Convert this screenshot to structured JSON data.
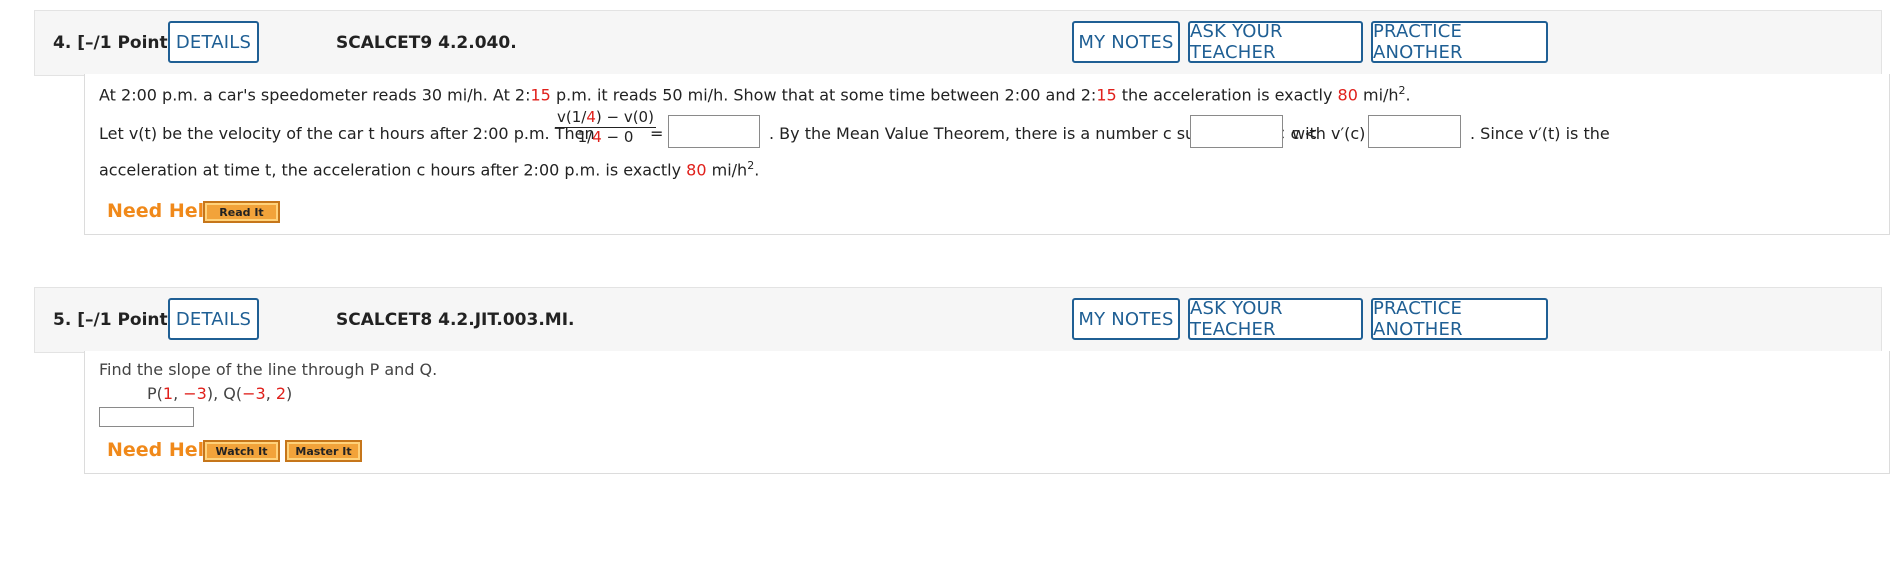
{
  "questions": [
    {
      "number": "4.",
      "points": "[–/1 Points]",
      "details_label": "DETAILS",
      "code": "SCALCET9 4.2.040.",
      "my_notes_label": "MY NOTES",
      "ask_teacher_label": "ASK YOUR TEACHER",
      "practice_another_label": "PRACTICE ANOTHER",
      "need_help_label": "Need Help?",
      "help_buttons": [
        "Read It"
      ],
      "problem": {
        "p1_a": "At 2:00 p.m. a car's speedometer reads 30 mi/h. At 2:",
        "p1_red1": "15",
        "p1_b": " p.m. it reads 50 mi/h. Show that at some time between 2:00 and 2:",
        "p1_red2": "15",
        "p1_c": " the acceleration is exactly ",
        "p1_red3": "80",
        "p1_d": " mi/h",
        "p1_sup": "2",
        "p1_e": ".",
        "p2_a": "Let v(t) be the velocity of the car t hours after 2:00 p.m. Then",
        "frac_num_a": "v(1/",
        "frac_num_red": "4",
        "frac_num_b": ") − v(0)",
        "frac_den_a": "1/",
        "frac_den_red": "4",
        "frac_den_b": " − 0",
        "equals": "=",
        "p2_b": ". By the Mean Value Theorem, there is a number c such that 0 < c <",
        "p2_c": "with v′(c) =",
        "p2_d": ". Since v′(t) is the",
        "p3_a": "acceleration at time t, the acceleration c hours after 2:00 p.m. is exactly ",
        "p3_red": "80",
        "p3_b": " mi/h",
        "p3_sup": "2",
        "p3_c": "."
      }
    },
    {
      "number": "5.",
      "points": "[–/1 Points]",
      "details_label": "DETAILS",
      "code": "SCALCET8 4.2.JIT.003.MI.",
      "my_notes_label": "MY NOTES",
      "ask_teacher_label": "ASK YOUR TEACHER",
      "practice_another_label": "PRACTICE ANOTHER",
      "need_help_label": "Need Help?",
      "help_buttons": [
        "Watch It",
        "Master It"
      ],
      "problem": {
        "p1": "Find the slope of the line through P and Q.",
        "pt_a": "P(",
        "pt_r1": "1",
        "pt_b": ", ",
        "pt_r2": "−3",
        "pt_c": "), Q(",
        "pt_r3": "−3",
        "pt_d": ", ",
        "pt_r4": "2",
        "pt_e": ")"
      }
    }
  ],
  "colors": {
    "accent": "#1f5f94",
    "highlight": "#e0201b",
    "help": "#f0891a",
    "button_orange": "#f2a33a"
  }
}
